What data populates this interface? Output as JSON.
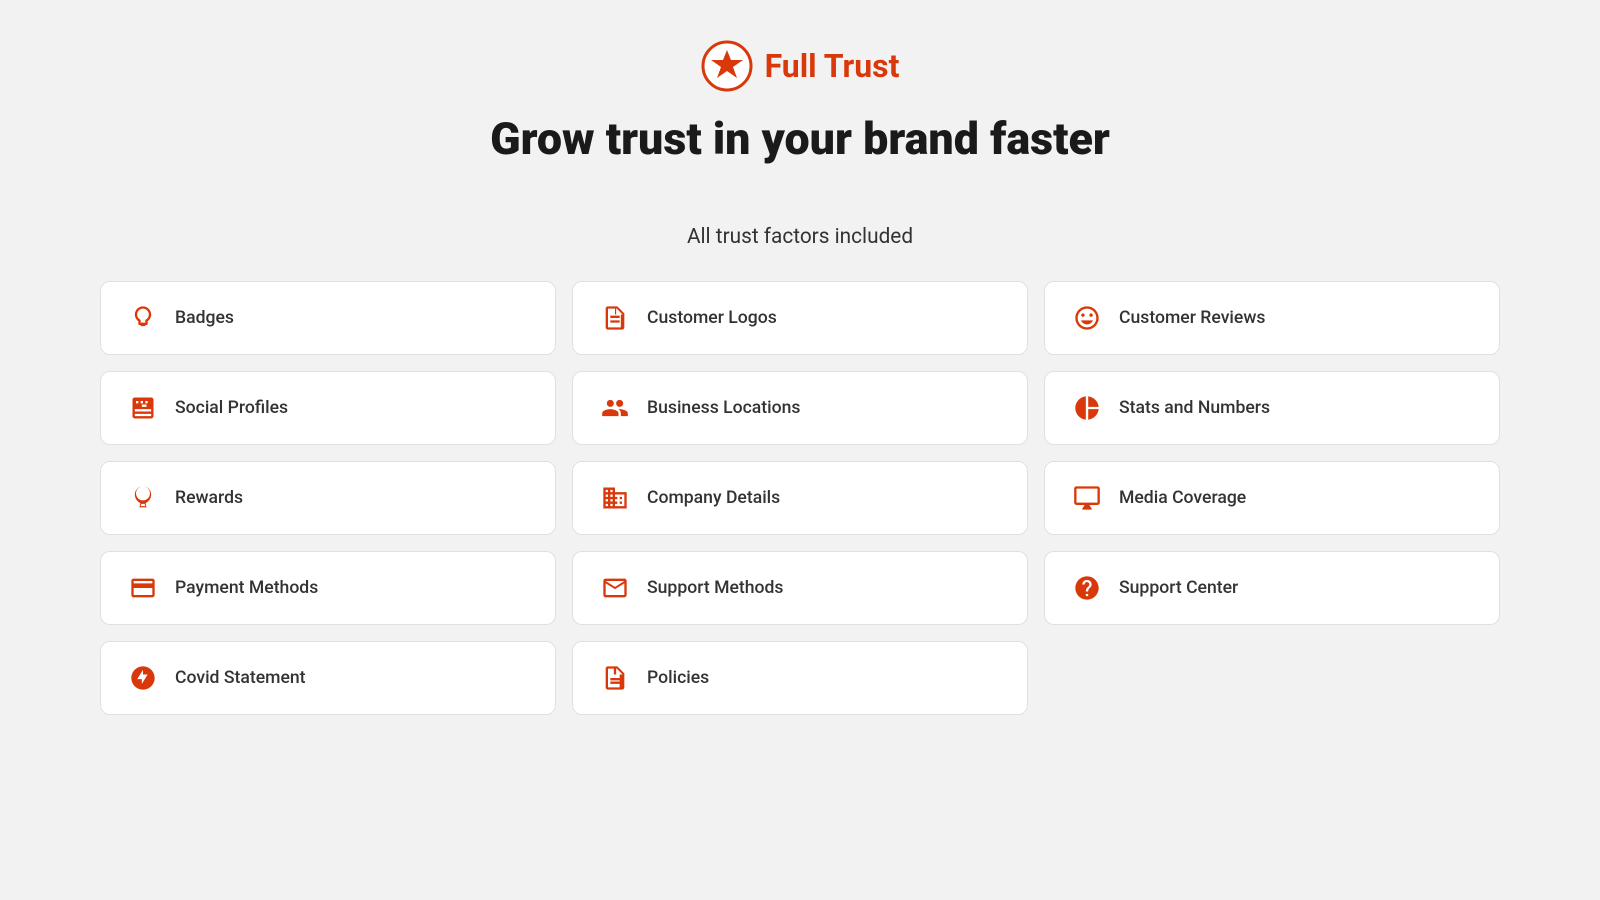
{
  "brand": {
    "name_part1": "Full ",
    "name_part2": "Trust"
  },
  "hero": {
    "title": "Grow trust in your brand faster"
  },
  "section": {
    "subtitle": "All trust factors included"
  },
  "cards": [
    {
      "id": "badges",
      "label": "Badges",
      "icon": "badges-icon",
      "col": 0
    },
    {
      "id": "customer-logos",
      "label": "Customer Logos",
      "icon": "customer-logos-icon",
      "col": 1
    },
    {
      "id": "customer-reviews",
      "label": "Customer Reviews",
      "icon": "customer-reviews-icon",
      "col": 2
    },
    {
      "id": "social-profiles",
      "label": "Social Profiles",
      "icon": "social-profiles-icon",
      "col": 0
    },
    {
      "id": "business-locations",
      "label": "Business Locations",
      "icon": "business-locations-icon",
      "col": 1
    },
    {
      "id": "stats-and-numbers",
      "label": "Stats and Numbers",
      "icon": "stats-icon",
      "col": 2
    },
    {
      "id": "rewards",
      "label": "Rewards",
      "icon": "rewards-icon",
      "col": 0
    },
    {
      "id": "company-details",
      "label": "Company Details",
      "icon": "company-details-icon",
      "col": 1
    },
    {
      "id": "media-coverage",
      "label": "Media Coverage",
      "icon": "media-coverage-icon",
      "col": 2
    },
    {
      "id": "payment-methods",
      "label": "Payment Methods",
      "icon": "payment-methods-icon",
      "col": 0
    },
    {
      "id": "support-methods",
      "label": "Support Methods",
      "icon": "support-methods-icon",
      "col": 1
    },
    {
      "id": "support-center",
      "label": "Support Center",
      "icon": "support-center-icon",
      "col": 2
    },
    {
      "id": "covid-statement",
      "label": "Covid Statement",
      "icon": "covid-icon",
      "col": 0
    },
    {
      "id": "policies",
      "label": "Policies",
      "icon": "policies-icon",
      "col": 1
    }
  ]
}
